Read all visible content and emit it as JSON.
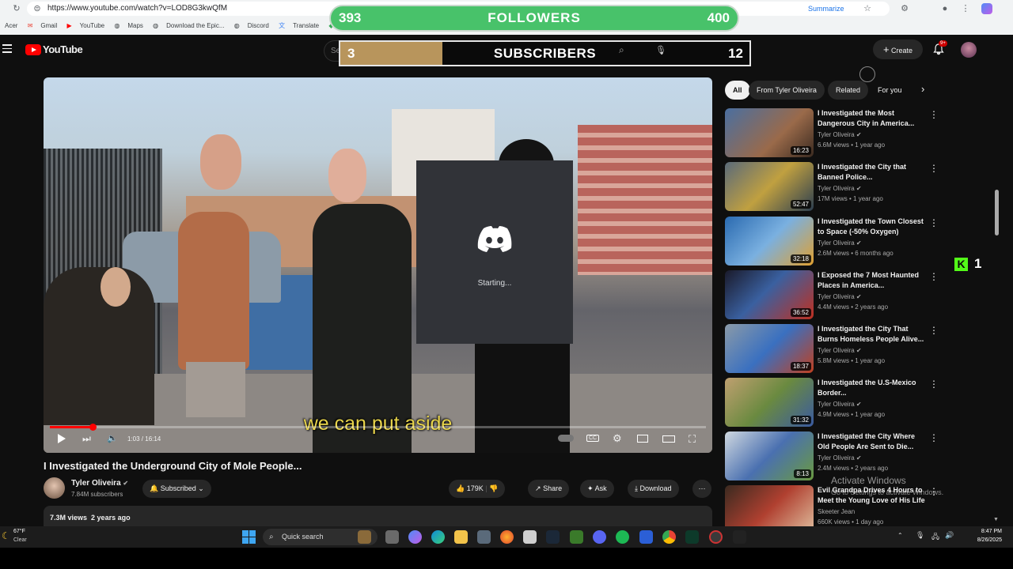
{
  "browser": {
    "url": "https://www.youtube.com/watch?v=LOD8G3kwQfM",
    "summarize_label": "Summarize",
    "bookmarks": [
      "Acer",
      "Gmail",
      "YouTube",
      "Maps",
      "Download the Epic...",
      "Discord",
      "Translate",
      "Av"
    ]
  },
  "overlay": {
    "followers": {
      "current": "393",
      "label": "FOLLOWERS",
      "goal": "400",
      "progress_fraction": 0.98
    },
    "subscribers": {
      "current": "3",
      "label": "SUBSCRIBERS",
      "goal": "12",
      "progress_fraction": 0.25
    },
    "kick_count": "1"
  },
  "header": {
    "logo_text": "YouTube",
    "search_placeholder": "Se",
    "create_label": "Create",
    "notification_badge": "9+"
  },
  "filters": [
    "All",
    "From Tyler Oliveira",
    "Related",
    "For you"
  ],
  "player": {
    "caption": "we can put aside",
    "time": "1:03 / 16:14",
    "progress_fraction": 0.065
  },
  "discord": {
    "status": "Starting..."
  },
  "video": {
    "title": "I Investigated the Underground City of Mole People...",
    "channel": "Tyler Oliveira",
    "subscribers": "7.84M subscribers",
    "subscribed_label": "Subscribed",
    "likes": "179K",
    "share_label": "Share",
    "ask_label": "Ask",
    "download_label": "Download",
    "views": "7.3M views",
    "age": "2 years ago"
  },
  "recommendations": [
    {
      "title": "I Investigated the Most Dangerous City in America...",
      "channel": "Tyler Oliveira",
      "meta": "6.6M views • 1 year ago",
      "duration": "16:23"
    },
    {
      "title": "I Investigated the City that Banned Police...",
      "channel": "Tyler Oliveira",
      "meta": "17M views • 1 year ago",
      "duration": "52:47"
    },
    {
      "title": "I Investigated the Town Closest to Space (-50% Oxygen)",
      "channel": "Tyler Oliveira",
      "meta": "2.6M views • 6 months ago",
      "duration": "32:18"
    },
    {
      "title": "I Exposed the 7 Most Haunted Places in America...",
      "channel": "Tyler Oliveira",
      "meta": "4.4M views • 2 years ago",
      "duration": "36:52"
    },
    {
      "title": "I Investigated the City That Burns Homeless People Alive...",
      "channel": "Tyler Oliveira",
      "meta": "5.8M views • 1 year ago",
      "duration": "18:37"
    },
    {
      "title": "I Investigated the U.S-Mexico Border...",
      "channel": "Tyler Oliveira",
      "meta": "4.9M views • 1 year ago",
      "duration": "31:32"
    },
    {
      "title": "I Investigated the City Where Old People Are Sent to Die...",
      "channel": "Tyler Oliveira",
      "meta": "2.4M views • 2 years ago",
      "duration": "8:13"
    },
    {
      "title": "Evil Grandpa Drives 4 Hours to Meet the Young Love of His Life",
      "channel": "Skeeter Jean",
      "meta": "660K views • 1 day ago",
      "duration": ""
    }
  ],
  "watermark": {
    "line1": "Activate Windows",
    "line2": "Go to Settings to activate Windows."
  },
  "taskbar": {
    "temperature": "67°F",
    "weather": "Clear",
    "search_label": "Quick search",
    "time": "8:47 PM",
    "date": "8/26/2025"
  },
  "colors": {
    "followers_bar": "#48c26a",
    "subscribers_fill": "#b8955c",
    "youtube_red": "#ff0000",
    "discord_blurple": "#5865f2",
    "kick_green": "#53fc18"
  }
}
